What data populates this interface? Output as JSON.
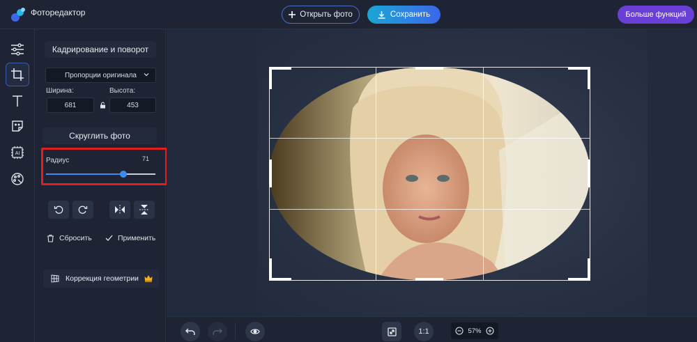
{
  "header": {
    "app_title": "Фоторедактор",
    "open_label": "Открыть фото",
    "save_label": "Сохранить",
    "more_label": "Больше функций"
  },
  "panel": {
    "title": "Кадрирование и поворот",
    "aspect_value": "Пропорции оригинала",
    "width_label": "Ширина:",
    "height_label": "Высота:",
    "width_value": "681",
    "height_value": "453",
    "round_label": "Скруглить фото",
    "radius_label": "Радиус",
    "radius_value": "71",
    "radius_fraction": 0.71,
    "reset_label": "Сбросить",
    "apply_label": "Применить",
    "geometry_label": "Коррекция геометрии"
  },
  "bottom": {
    "ratio_label": "1:1",
    "zoom_value": "57%"
  },
  "colors": {
    "accent": "#3d8bf2",
    "highlight": "#e02020",
    "more_button": "#6a3fd6",
    "premium_crown": "#f2b01e"
  }
}
